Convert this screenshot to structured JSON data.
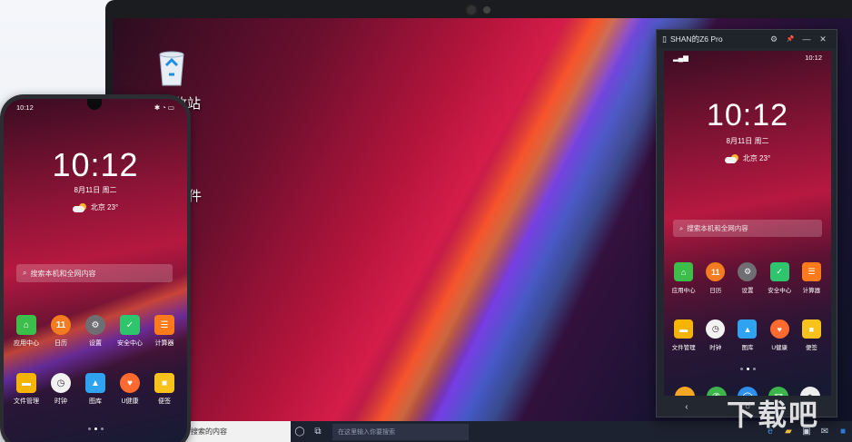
{
  "desktop": {
    "labels": [
      "回收站",
      "件"
    ],
    "taskbar": {
      "search_placeholder": "搜索的内容",
      "edge_search_placeholder": "在这里输入你要搜索"
    }
  },
  "phone_window": {
    "title": "SHAN的Z6 Pro",
    "controls": [
      "⚙",
      "📌",
      "—",
      "✕"
    ]
  },
  "phone_ui": {
    "status_time": "10:12",
    "clock": "10:12",
    "date": "8月11日  周二",
    "weather": "北京  23°",
    "search_placeholder": "搜索本机和全网内容",
    "apps_row1": [
      {
        "label": "应用中心",
        "color": "#3cbf4a",
        "glyph": "⌂"
      },
      {
        "label": "日历",
        "color": "#f47b20",
        "glyph": "11"
      },
      {
        "label": "设置",
        "color": "#6e6e73",
        "glyph": "⚙"
      },
      {
        "label": "安全中心",
        "color": "#2ec56c",
        "glyph": "✓"
      },
      {
        "label": "计算器",
        "color": "#ff7a1a",
        "glyph": "☰"
      }
    ],
    "apps_row2": [
      {
        "label": "文件管理",
        "color": "#f5b400",
        "glyph": "▬"
      },
      {
        "label": "时钟",
        "color": "#f2f2f2",
        "glyph": "◷"
      },
      {
        "label": "图库",
        "color": "#2fa3f0",
        "glyph": "▲"
      },
      {
        "label": "U健康",
        "color": "#ff6a2e",
        "glyph": "♥"
      },
      {
        "label": "便签",
        "color": "#f7c21b",
        "glyph": "■"
      }
    ],
    "dock": [
      {
        "name": "messages",
        "color": "#f5a623",
        "glyph": "…"
      },
      {
        "name": "phone",
        "color": "#3cb54a",
        "glyph": "✆"
      },
      {
        "name": "browser",
        "color": "#2f8fef",
        "glyph": "◯"
      },
      {
        "name": "wechat",
        "color": "#3cb54a",
        "glyph": "✉"
      },
      {
        "name": "camera",
        "color": "#eeeeee",
        "glyph": "●"
      }
    ],
    "nav": [
      "‹",
      "○",
      "›"
    ]
  },
  "watermark": "下载吧"
}
